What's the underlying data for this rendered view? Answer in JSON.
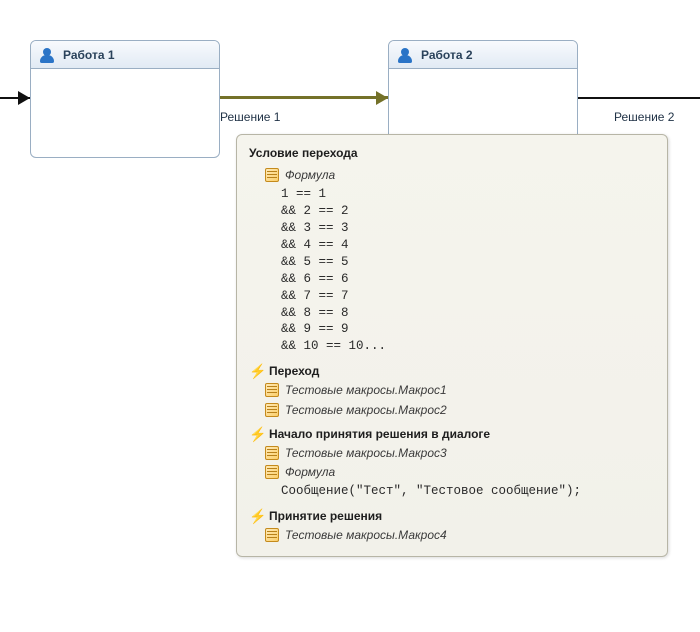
{
  "workflow": {
    "node1": {
      "title": "Работа 1"
    },
    "node2": {
      "title": "Работа 2"
    },
    "edge1": {
      "label": "Решение 1"
    },
    "edge2": {
      "label": "Решение 2"
    }
  },
  "tooltip": {
    "title": "Условие перехода",
    "formula_label": "Формула",
    "formula_lines": "1 == 1\n&& 2 == 2\n&& 3 == 3\n&& 4 == 4\n&& 5 == 5\n&& 6 == 6\n&& 7 == 7\n&& 8 == 8\n&& 9 == 9\n&& 10 == 10...",
    "sections": {
      "transition": {
        "title": "Переход",
        "items": [
          "Тестовые макросы.Макрос1",
          "Тестовые макросы.Макрос2"
        ]
      },
      "dialog_start": {
        "title": "Начало принятия решения в диалоге",
        "items": [
          "Тестовые макросы.Макрос3"
        ],
        "formula_label": "Формула",
        "formula_code": "Сообщение(\"Тест\", \"Тестовое сообщение\");"
      },
      "decision": {
        "title": "Принятие решения",
        "items": [
          "Тестовые макросы.Макрос4"
        ]
      }
    }
  }
}
